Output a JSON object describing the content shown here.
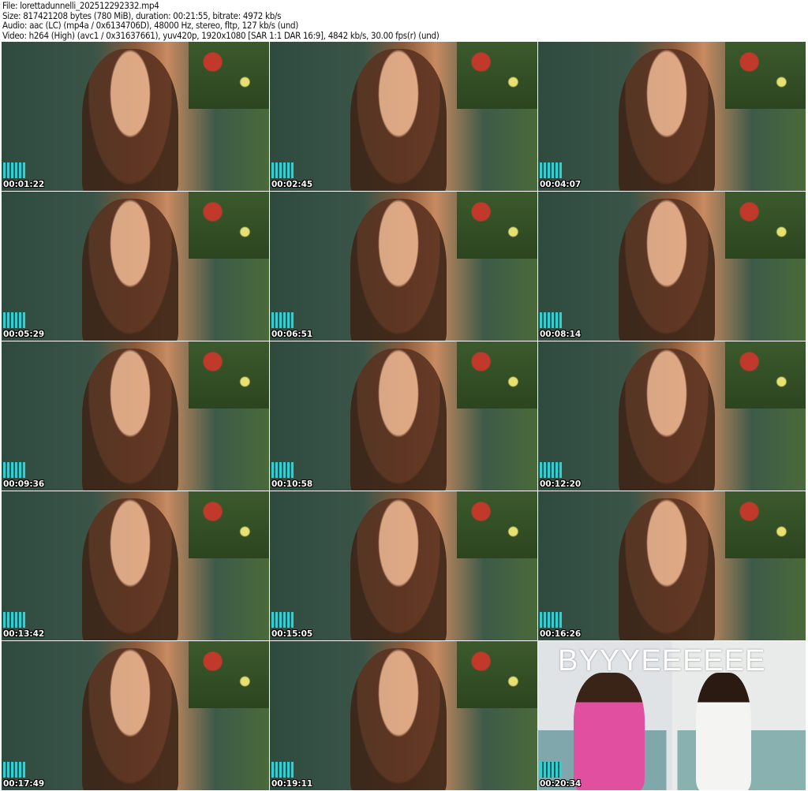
{
  "header": {
    "file": "File: lorettadunnelli_202512292332.mp4",
    "size": "Size: 817421208 bytes (780 MiB), duration: 00:21:55, bitrate: 4972 kb/s",
    "audio": "Audio: aac (LC) (mp4a / 0x6134706D), 48000 Hz, stereo, fltp, 127 kb/s (und)",
    "video": "Video: h264 (High) (avc1 / 0x31637661), yuv420p, 1920x1080 [SAR 1:1 DAR 16:9], 4842 kb/s, 30.00 fps(r) (und)"
  },
  "thumbnails": [
    {
      "timestamp": "00:01:22"
    },
    {
      "timestamp": "00:02:45"
    },
    {
      "timestamp": "00:04:07"
    },
    {
      "timestamp": "00:05:29"
    },
    {
      "timestamp": "00:06:51"
    },
    {
      "timestamp": "00:08:14"
    },
    {
      "timestamp": "00:09:36"
    },
    {
      "timestamp": "00:10:58"
    },
    {
      "timestamp": "00:12:20"
    },
    {
      "timestamp": "00:13:42"
    },
    {
      "timestamp": "00:15:05"
    },
    {
      "timestamp": "00:16:26"
    },
    {
      "timestamp": "00:17:49"
    },
    {
      "timestamp": "00:19:11"
    },
    {
      "timestamp": "00:20:34",
      "caption": "BYYYEEEEEE"
    }
  ]
}
